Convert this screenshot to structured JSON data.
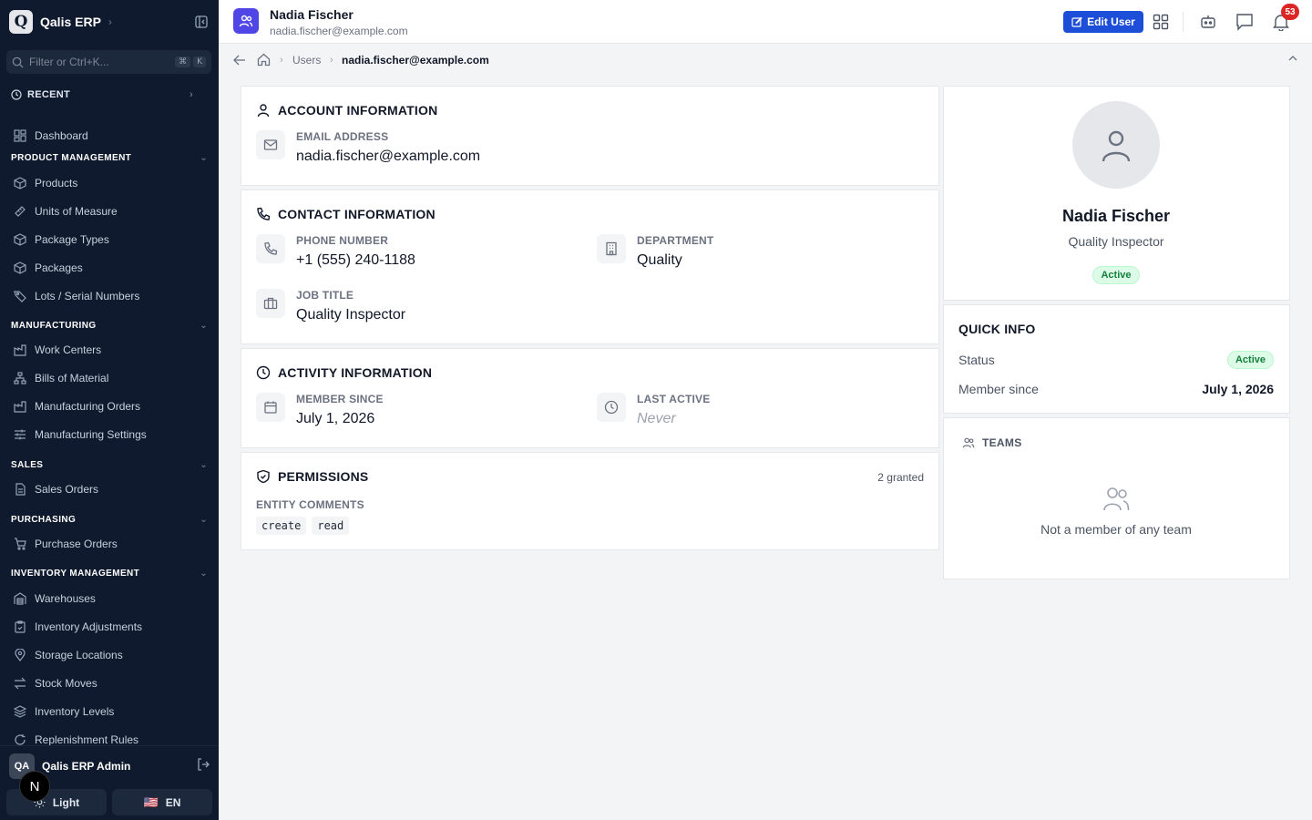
{
  "app": {
    "logo_letter": "Q",
    "name": "Qalis ERP"
  },
  "sidebar": {
    "search_placeholder": "Filter or Ctrl+K...",
    "search_kbd": [
      "⌘",
      "K"
    ],
    "recent_label": "RECENT",
    "dashboard": "Dashboard",
    "sections": {
      "product": "PRODUCT MANAGEMENT",
      "manufacturing": "MANUFACTURING",
      "sales": "SALES",
      "purchasing": "PURCHASING",
      "inventory": "INVENTORY MANAGEMENT"
    },
    "items": {
      "products": "Products",
      "units": "Units of Measure",
      "package_types": "Package Types",
      "packages": "Packages",
      "lots": "Lots / Serial Numbers",
      "work_centers": "Work Centers",
      "boms": "Bills of Material",
      "mos": "Manufacturing Orders",
      "mfg_settings": "Manufacturing Settings",
      "sales_orders": "Sales Orders",
      "purchase_orders": "Purchase Orders",
      "warehouses": "Warehouses",
      "inv_adjust": "Inventory Adjustments",
      "storage_locations": "Storage Locations",
      "stock_moves": "Stock Moves",
      "inv_levels": "Inventory Levels",
      "replenishment": "Replenishment Rules"
    },
    "user": {
      "initials": "QA",
      "name": "Qalis ERP Admin"
    },
    "n_badge": "N",
    "theme_label": "Light",
    "lang_label": "EN",
    "lang_flag": "🇺🇸"
  },
  "header": {
    "name": "Nadia Fischer",
    "email": "nadia.fischer@example.com",
    "edit_label": "Edit User",
    "notif_count": "53"
  },
  "breadcrumb": {
    "users": "Users",
    "current": "nadia.fischer@example.com"
  },
  "account": {
    "title": "ACCOUNT INFORMATION",
    "email_label": "EMAIL ADDRESS",
    "email_value": "nadia.fischer@example.com"
  },
  "contact": {
    "title": "CONTACT INFORMATION",
    "phone_label": "PHONE NUMBER",
    "phone_value": "+1 (555) 240-1188",
    "dept_label": "DEPARTMENT",
    "dept_value": "Quality",
    "job_label": "JOB TITLE",
    "job_value": "Quality Inspector"
  },
  "activity": {
    "title": "ACTIVITY INFORMATION",
    "member_label": "MEMBER SINCE",
    "member_value": "July 1, 2026",
    "last_label": "LAST ACTIVE",
    "last_value": "Never"
  },
  "permissions": {
    "title": "PERMISSIONS",
    "granted": "2 granted",
    "group_label": "ENTITY COMMENTS",
    "chips": [
      "create",
      "read"
    ]
  },
  "profile": {
    "name": "Nadia Fischer",
    "job_title": "Quality Inspector",
    "status": "Active"
  },
  "quick_info": {
    "title": "QUICK INFO",
    "status_label": "Status",
    "status_value": "Active",
    "member_label": "Member since",
    "member_value": "July 1, 2026"
  },
  "teams": {
    "title": "TEAMS",
    "empty": "Not a member of any team"
  },
  "colors": {
    "sidebar_bg": "#0f1a2e",
    "accent": "#1d4ed8",
    "active_green": "#15803d",
    "notif_red": "#dc2626"
  }
}
